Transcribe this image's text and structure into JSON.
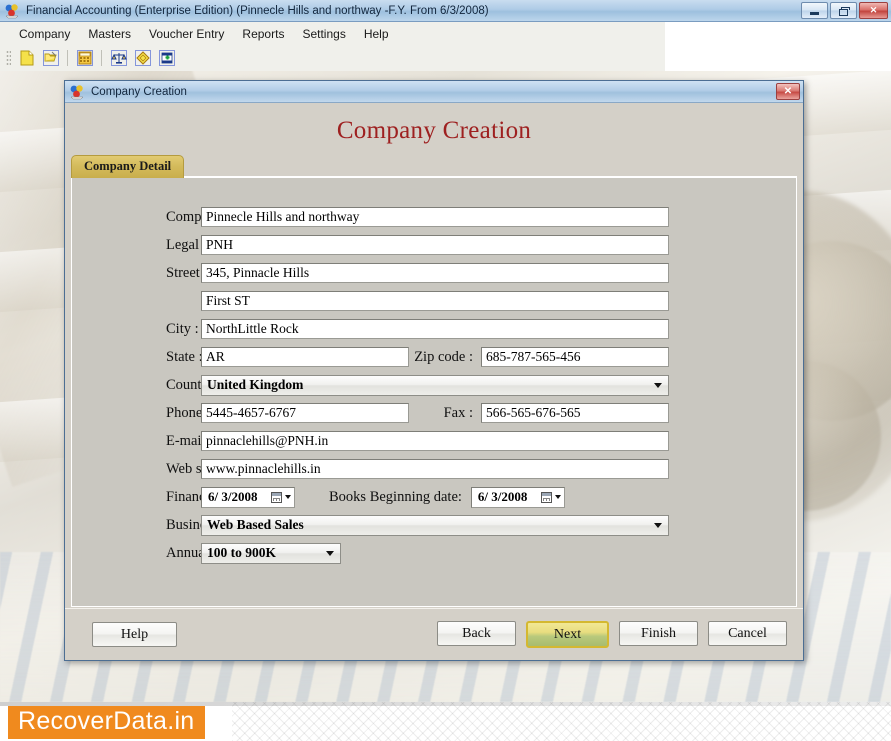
{
  "window": {
    "title": "Financial Accounting (Enterprise Edition) (Pinnecle Hills and northway -F.Y. From 6/3/2008)",
    "icon": "app-icon",
    "controls": {
      "minimize": "minimize-button",
      "restore": "restore-button",
      "close_label": "✕"
    }
  },
  "menubar": {
    "items": [
      {
        "label": "Company"
      },
      {
        "label": "Masters"
      },
      {
        "label": "Voucher Entry"
      },
      {
        "label": "Reports"
      },
      {
        "label": "Settings"
      },
      {
        "label": "Help"
      }
    ]
  },
  "toolbar": {
    "buttons": [
      {
        "name": "new-company-icon"
      },
      {
        "name": "open-company-icon"
      },
      {
        "name": "calculator-icon"
      },
      {
        "name": "balance-scales-icon"
      },
      {
        "name": "ledger-icon"
      },
      {
        "name": "report-icon"
      }
    ]
  },
  "dialog": {
    "titlebar_text": "Company Creation",
    "close_label": "✕",
    "heading": "Company Creation",
    "tab": {
      "label": "Company Detail"
    },
    "fields": {
      "company_name": {
        "label": "Company name :",
        "value": "Pinnecle Hills and northway"
      },
      "legal_name": {
        "label": "Legal name :",
        "value": "PNH"
      },
      "street": {
        "label": "Street :",
        "value": "345, Pinnacle Hills"
      },
      "street2": {
        "label": "",
        "value": "First ST"
      },
      "city": {
        "label": "City :",
        "value": "NorthLittle Rock"
      },
      "state": {
        "label": "State :",
        "value": "AR"
      },
      "zip_code": {
        "label": "Zip code :",
        "value": "685-787-565-456"
      },
      "country": {
        "label": "Country :",
        "value": "United Kingdom"
      },
      "phone": {
        "label": "Phone :",
        "value": "5445-4657-6767"
      },
      "fax": {
        "label": "Fax :",
        "value": "566-565-676-565"
      },
      "email": {
        "label": "E-mail :",
        "value": "pinnaclehills@PNH.in"
      },
      "website": {
        "label": "Web site :",
        "value": "www.pinnaclehills.in"
      },
      "financial_year_from": {
        "label": "Financial year from :",
        "value": "6/  3/2008"
      },
      "books_beginning_date": {
        "label": "Books Beginning date:",
        "value": "6/  3/2008"
      },
      "business_type": {
        "label": "Business type :",
        "value": "Web Based Sales"
      },
      "annual_revenue": {
        "label": "Annual revenue :",
        "value": "100 to 900K"
      }
    },
    "buttons": {
      "help": "Help",
      "back": "Back",
      "next": "Next",
      "finish": "Finish",
      "cancel": "Cancel"
    }
  },
  "watermark": {
    "text": "RecoverData.in"
  },
  "colors": {
    "heading": "#9e2020",
    "tab_gold": "#d4bb5c",
    "primary_button": "#b9c97c",
    "watermark_orange": "#f08a1e",
    "titlebar_blue": "#aecbe6"
  }
}
